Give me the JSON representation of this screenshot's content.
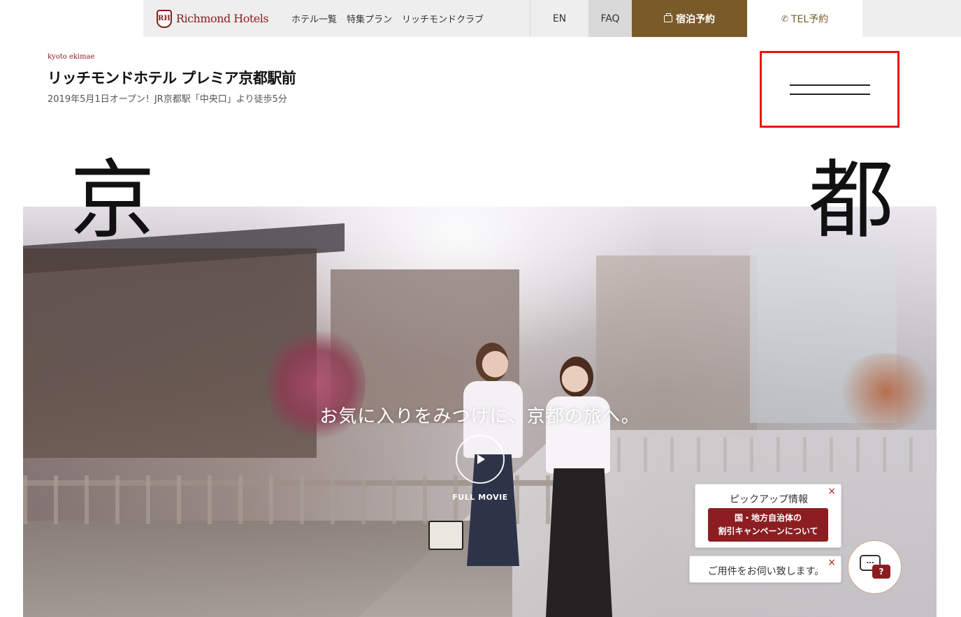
{
  "brand": {
    "logo_mark": "RH",
    "logo_text": "Richmond Hotels"
  },
  "nav": {
    "links": [
      "ホテル一覧",
      "特集プラン",
      "リッチモンドクラブ"
    ],
    "en": "EN",
    "faq": "FAQ",
    "reserve": "宿泊予約",
    "tel": "TEL予約"
  },
  "hotel": {
    "subname": "kyoto ekimae",
    "title": "リッチモンドホテル プレミア京都駅前",
    "subtitle": "2019年5月1日オープン！JR京都駅「中央口」より徒歩5分"
  },
  "hero": {
    "kanji_left": "京",
    "kanji_right": "都",
    "copy": "お気に入りをみつけに、京都の旅へ。",
    "play_label": "FULL MOVIE"
  },
  "pickup": {
    "title": "ピックアップ情報",
    "close": "×",
    "button_line1": "国・地方自治体の",
    "button_line2": "割引キャンペーンについて"
  },
  "help": {
    "text": "ご用件をお伺い致します。",
    "close": "×"
  },
  "chat": {
    "bubble": "…",
    "badge": "?"
  },
  "icons": {
    "reserve": "suitcase-icon",
    "tel": "phone-icon",
    "menu": "hamburger-menu-icon",
    "play": "play-icon",
    "chat": "chat-help-icon"
  },
  "colors": {
    "brand": "#8a1c1c",
    "reserve_bg": "#7a5a28",
    "highlight": "#ee1111",
    "pickup_btn": "#8c1e22"
  }
}
